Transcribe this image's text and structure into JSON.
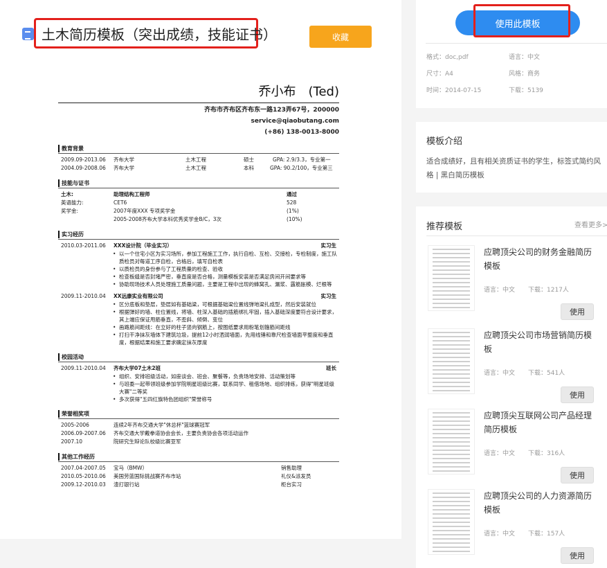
{
  "title": "土木简历模板（突出成绩，技能证书）",
  "favorite_label": "收藏",
  "resume": {
    "name": "乔小布　(Ted)",
    "address": "齐布市齐布区齐布东一路123弄67号，200000",
    "email": "service@qiaobutang.com",
    "phone": "(+86) 138-0013-8000",
    "education": {
      "title": "教育背景",
      "rows": [
        [
          "2009.09-2013.06",
          "齐布大学",
          "土木工程",
          "硕士",
          "GPA: 2.9/3.3，专业第一"
        ],
        [
          "2004.09-2008.06",
          "齐布大学",
          "土木工程",
          "本科",
          "GPA: 90.2/100，专业第三"
        ]
      ]
    },
    "skills": {
      "title": "技能与证书",
      "rows": [
        [
          "土木:",
          "助理结构工程师",
          "通过"
        ],
        [
          "英语能力:",
          "CET6",
          "528"
        ],
        [
          "奖学金:",
          "2007年度XXX 专项奖学金",
          "(1%)"
        ],
        [
          "",
          "2005-2008齐布大学本科优秀奖学金B/C，3次",
          "(10%)"
        ]
      ]
    },
    "internship": {
      "title": "实习经历",
      "jobs": [
        {
          "date": "2010.03-2011.06",
          "company": "XXX设计院（毕业实习）",
          "role": "实习生",
          "bullets": [
            "以一个住宅小区为实习场所，参加工程施工工作，执行自检、互检、交接检，专检制度，施工队质检员对每道工序自检，合格后，填写自检表",
            "以质检员的身份参与了工程质量的检查、验收",
            "检查板缝是否封堵严密，垂直度是否合格，测量模板安装是否满足房间开间要求等",
            "协助现场技术人员处理施工质量问题，主要是工程中出现的蜂窝孔、漏浆、露筋胀模、烂根等"
          ]
        },
        {
          "date": "2009.11-2010.04",
          "company": "XX远康实业有限公司",
          "role": "实习生",
          "bullets": [
            "区分底板和垫层，垫层如有基础梁，可根据基础梁位置线弹地梁扎成型，然后安装就位",
            "根据弹好的墙、柱位置线，将墙、柱深入基础的插筋绑扎牢固，插入基础深度要符合设计要求，其上端应保证甩筋垂直，不歪斜、倾倒、变位",
            "画路筋间距线：在立好的柱子竖向钢筋上，按图纸要求用粉笔划箍筋间距线",
            "打扫干净抹灰墙体下建筑垃圾，提前12小时洒润墙面，先用线锤和靠尺检查墙面平整度和垂直度，根据结果和施工要求确定抹灰厚度"
          ]
        }
      ]
    },
    "campus": {
      "title": "校园活动",
      "date": "2009.11-2010.04",
      "org": "齐布大学07土木2班",
      "role": "班长",
      "bullets": [
        "组织、安排班级活动，如座谈会、班会、聚餐等，负责场地安排、活动策划等",
        "与班委一起带领班级参加学院明星班级比赛，联系同学、租借场地、组织排练，获得\"明星班级大赛\"二等奖",
        "多次获得\"五四红旗特色团组织\"荣誉称号"
      ]
    },
    "awards": {
      "title": "荣誉相奖项",
      "rows": [
        [
          "2005-2006",
          "连续2年齐布交通大学\"休总杯\"篮球赛冠军"
        ],
        [
          "2006.09-2007.06",
          "齐布交通大学戴拳道协会会长，主要负责协会各项活动运作"
        ],
        [
          "2007.10",
          "院研究生辩论队校级比赛亚军"
        ]
      ]
    },
    "other": {
      "title": "其他工作经历",
      "rows": [
        [
          "2007.04-2007.05",
          "宝马（BMW）",
          "销售助理"
        ],
        [
          "2010.05-2010.06",
          "美国劳蓝国际挑战赛齐布市站",
          "礼仪&派发员"
        ],
        [
          "2009.12-2010.03",
          "渣打银行站",
          "柜台实习"
        ]
      ]
    }
  },
  "sidebar": {
    "use_template_label": "使用此模板",
    "meta": {
      "format": "格式：doc,pdf",
      "language": "语言：中文",
      "size": "尺寸：A4",
      "style": "风格：商务",
      "time": "时间：2014-07-15",
      "downloads": "下载：5139"
    },
    "intro_title": "模板介绍",
    "intro_text": "适合成绩好，且有相关资质证书的学生，标签式简约风格 | 黑白简历模板",
    "recommend_title": "推荐模板",
    "more_label": "查看更多>",
    "recommendations": [
      {
        "title": "应聘顶尖公司的财务金融简历模板",
        "language": "语言：中文",
        "downloads": "下载：1217人",
        "button": "使用"
      },
      {
        "title": "应聘顶尖公司市场营销简历模板",
        "language": "语言：中文",
        "downloads": "下载：541人",
        "button": "使用"
      },
      {
        "title": "应聘顶尖互联网公司产品经理简历模板",
        "language": "语言：中文",
        "downloads": "下载：316人",
        "button": "使用"
      },
      {
        "title": "应聘顶尖公司的人力资源简历模板",
        "language": "语言：中文",
        "downloads": "下载：157人",
        "button": "使用"
      }
    ]
  }
}
